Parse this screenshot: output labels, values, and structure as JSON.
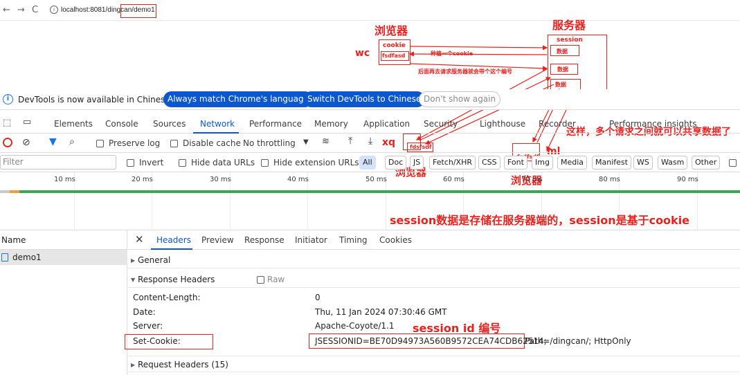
{
  "browser": {
    "url": "localhost:8081/dingcan/demo1",
    "back_icon": "arrow-left-icon",
    "forward_icon": "arrow-right-icon",
    "reload_icon": "reload-icon"
  },
  "annotations": {
    "client_label_top": "浏览器",
    "server_label": "服务器",
    "wc": "wc",
    "cookie": "cookie",
    "fsdfasd": "fsdfasd",
    "transfer_note": "种植一个cookie",
    "later_note": "后面再去请求服务器就会带个这个编号",
    "session": "session",
    "data1": "数据",
    "data2": "数据",
    "data3": "数据",
    "xq": "xq",
    "fdsfsdf": "fdsfsdf",
    "client_label_mid": "浏览器",
    "fsdfsdf": "fsdfsdf",
    "ml": "ml",
    "client_label_right": "浏览器",
    "share_note": "这样，多个请求之间就可以共享数据了",
    "session_note": "session数据是存储在服务器端的，session是基于cookie",
    "session_id_note": "session  id 编号"
  },
  "infobar": {
    "message": "DevTools is now available in Chinese!",
    "btn_match": "Always match Chrome's language",
    "btn_switch": "Switch DevTools to Chinese",
    "btn_dismiss": "Don't show again"
  },
  "tabs": [
    "Elements",
    "Console",
    "Sources",
    "Network",
    "Performance",
    "Memory",
    "Application",
    "Security",
    "Lighthouse",
    "Recorder",
    "Performance insights"
  ],
  "toolbar": {
    "preserve_log": "Preserve log",
    "disable_cache": "Disable cache",
    "throttling": "No throttling"
  },
  "filter": {
    "placeholder": "Filter",
    "invert": "Invert",
    "hide_data_urls": "Hide data URLs",
    "hide_ext_urls": "Hide extension URLs",
    "types": [
      "All",
      "Doc",
      "JS",
      "Fetch/XHR",
      "CSS",
      "Font",
      "Img",
      "Media",
      "Manifest",
      "WS",
      "Wasm",
      "Other"
    ]
  },
  "timeline": {
    "ticks": [
      "10 ms",
      "20 ms",
      "30 ms",
      "40 ms",
      "50 ms",
      "60 ms",
      "70 ms",
      "80 ms",
      "90 ms"
    ]
  },
  "requests": {
    "header": "Name",
    "items": [
      "demo1"
    ]
  },
  "detail_tabs": [
    "Headers",
    "Preview",
    "Response",
    "Initiator",
    "Timing",
    "Cookies"
  ],
  "sections": {
    "general": "General",
    "response_headers": "Response Headers",
    "raw": "Raw",
    "request_headers": "Request Headers (15)"
  },
  "response_headers": [
    {
      "key": "Content-Length:",
      "value": "0"
    },
    {
      "key": "Date:",
      "value": "Thu, 11 Jan 2024 07:30:46 GMT"
    },
    {
      "key": "Server:",
      "value": "Apache-Coyote/1.1"
    },
    {
      "key": "Set-Cookie:",
      "value": "JSESSIONID=BE70D94973A560B9572CEA74CDB62514;",
      "value_rest": " Path=/dingcan/; HttpOnly"
    }
  ]
}
